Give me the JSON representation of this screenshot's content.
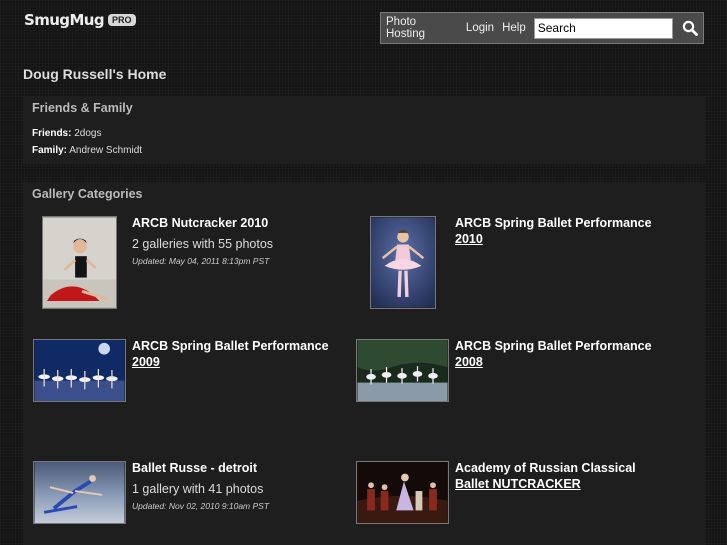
{
  "brand": {
    "name": "SmugMug",
    "badge": "PRO"
  },
  "nav": {
    "photo_hosting": "Photo Hosting",
    "login": "Login",
    "help": "Help"
  },
  "search": {
    "placeholder": "Search"
  },
  "page_title": "Doug Russell's Home",
  "friends_family": {
    "title": "Friends & Family",
    "friends_label": "Friends:",
    "friends_value": "2dogs",
    "family_label": "Family:",
    "family_value": "Andrew Schmidt"
  },
  "categories": {
    "title": "Gallery Categories",
    "items": [
      {
        "title_line1": "ARCB Nutcracker 2010",
        "title_line2": "",
        "subtitle": "2 galleries with 55 photos",
        "updated": "Updated: May 04, 2011 8:13pm PST"
      },
      {
        "title_line1": "ARCB Spring Ballet Performance",
        "title_line2": "2010",
        "subtitle": "",
        "updated": ""
      },
      {
        "title_line1": "ARCB Spring Ballet Performance",
        "title_line2": "2009",
        "subtitle": "",
        "updated": ""
      },
      {
        "title_line1": "ARCB Spring Ballet Performance",
        "title_line2": "2008",
        "subtitle": "",
        "updated": ""
      },
      {
        "title_line1": "Ballet Russe - detroit",
        "title_line2": "",
        "subtitle": "1 gallery with 41 photos",
        "updated": "Updated: Nov 02, 2010 9:10am PST"
      },
      {
        "title_line1": "Academy of Russian Classical",
        "title_line2": "Ballet NUTCRACKER",
        "subtitle": "",
        "updated": ""
      }
    ]
  }
}
